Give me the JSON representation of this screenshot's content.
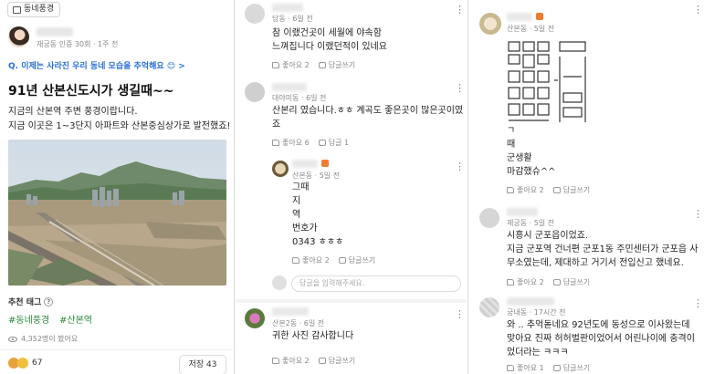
{
  "post": {
    "category_tag": "동네풍경",
    "author_meta": "재궁동 인증 30회 · 1주 전",
    "question": "Q. 이제는 사라진 우리 동네 모습을 추억해요 😊 >",
    "title": "91년 산본신도시가 생길때~~",
    "body": [
      "지금의 산본역 주변 풍경이랍니다.",
      "지금 이곳은 1~3단지 아파트와 산본중심상가로 발전했죠!"
    ],
    "recommend_label": "추천 태그",
    "hashtags": [
      "#동네풍경",
      "#산본역"
    ],
    "views": "4,352명이 봤어요",
    "reaction_count": "67",
    "save_label": "저장 43",
    "icons": {
      "eye": "eye-icon",
      "help": "help-icon",
      "tag": "document-icon"
    }
  },
  "comments_mid": [
    {
      "meta": "당동 · 6일 전",
      "lines": [
        "참 이랬건곳이 세월에 야속함",
        "느껴집니다 이랬던적이 있네요"
      ],
      "like": "좋아요 2",
      "reply": "답글쓰기"
    },
    {
      "meta": "대야미동 · 6일 전",
      "lines": [
        "산본리 였습니다.ㅎㅎ 계곡도 좋은곳이 많은곳이였",
        "죠"
      ],
      "like": "좋아요 6",
      "reply": "답글 1"
    },
    {
      "meta": "산본동 · 5일 전",
      "lines": [
        "그때",
        "지",
        "역",
        "번호가",
        "0343 ㅎㅎㅎ"
      ],
      "like": "좋아요 2",
      "reply": "답글쓰기"
    },
    {
      "meta": "산본2동 · 6일 전",
      "lines": [
        "귀한 사진 감사합니다"
      ],
      "like": "좋아요 2",
      "reply": "답글쓰기"
    }
  ],
  "reply_placeholder": "답글을 입력해주세요.",
  "comments_right": [
    {
      "meta": "산본동 · 5일 전",
      "lines": [
        "ㄱ",
        "때",
        "군생활",
        "마감했슈^^"
      ],
      "like": "좋아요 2",
      "reply": "답글쓰기"
    },
    {
      "meta": "재궁동 · 5일 전",
      "lines": [
        "시흥시 군포읍이었죠.",
        "지금 군포역 건너편 군포1동 주민센터가 군포읍 사",
        "무소였는데, 제대하고 거기서 전입신고 했네요."
      ],
      "like": "좋아요 2",
      "reply": "답글쓰기"
    },
    {
      "meta": "궁내동 · 17시간 전",
      "lines": [
        "와 .. 추억돋네요 92년도에 동성으로 이사왔는데",
        "맞아요 진짜 허허벌판이었어서 어린나이에 충격이",
        "었더라는 ㅋㅋㅋ"
      ],
      "like": "좋아요 1",
      "reply": "답글쓰기"
    }
  ],
  "colors": {
    "accent_blue": "#2a6fd6",
    "hashtag_green": "#2a8a3c",
    "badge_orange": "#f07b2e"
  }
}
